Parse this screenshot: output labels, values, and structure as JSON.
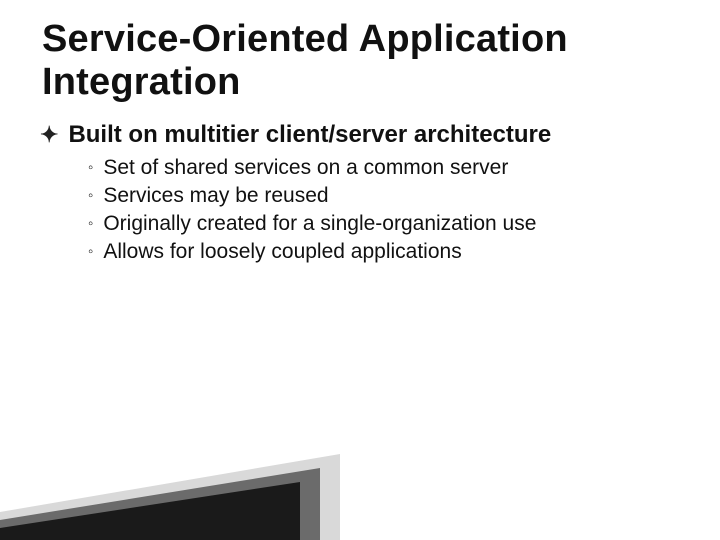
{
  "title": "Service-Oriented Application Integration",
  "bullet": {
    "text": "Built on multitier client/server architecture",
    "sub": [
      "Set of shared services on a common server",
      "Services may be reused",
      "Originally created for a single-organization use",
      "Allows for loosely coupled applications"
    ]
  }
}
